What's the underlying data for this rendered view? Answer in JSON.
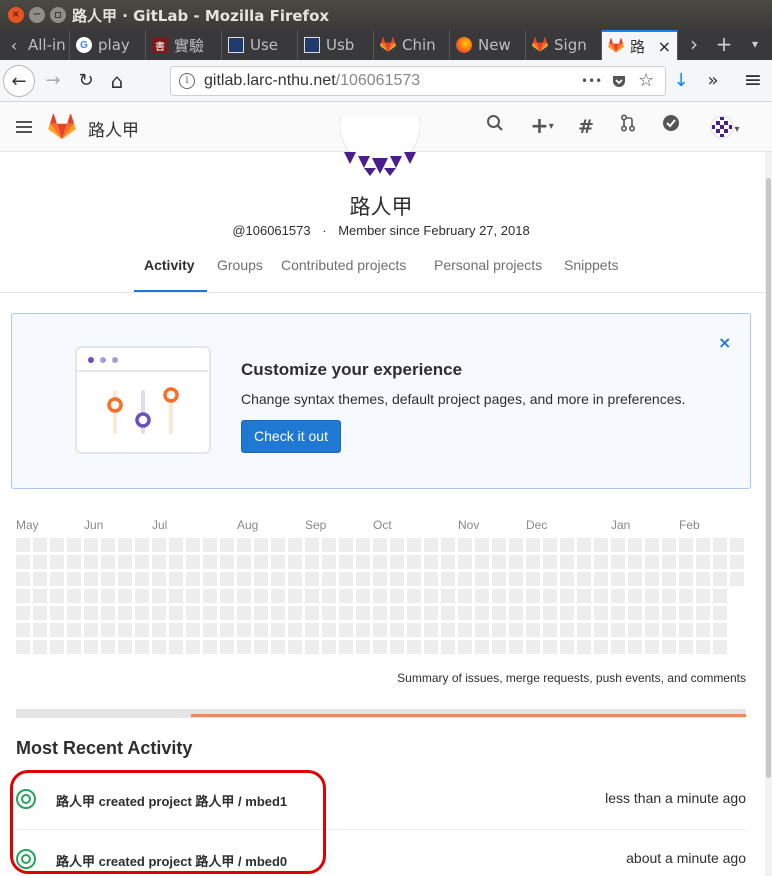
{
  "window": {
    "title": "路人甲 · GitLab - Mozilla Firefox",
    "close_glyph": "×",
    "minimize_glyph": "−"
  },
  "tabs": [
    {
      "label": "All-in",
      "icon": "scroll-left-icon"
    },
    {
      "label": "play",
      "icon": "google-icon"
    },
    {
      "label": "實驗",
      "icon": "book-icon"
    },
    {
      "label": "Use",
      "icon": "document-icon"
    },
    {
      "label": "Usb",
      "icon": "document-icon"
    },
    {
      "label": "Chin",
      "icon": "gitlab-icon"
    },
    {
      "label": "New",
      "icon": "firefox-icon"
    },
    {
      "label": "Sign",
      "icon": "gitlab-icon"
    },
    {
      "label": "路",
      "icon": "gitlab-icon",
      "active": true
    }
  ],
  "tabstrip": {
    "more": "›",
    "new_tab": "+",
    "close": "×"
  },
  "navbar": {
    "back": "←",
    "forward": "→",
    "reload": "↻",
    "home": "⌂",
    "url_host": "gitlab.larc-nthu.net",
    "url_path": "/106061573",
    "info": "i",
    "page_actions": "•••",
    "download": "↓",
    "overflow": "»",
    "menu": "≡"
  },
  "gitlab_header": {
    "username": "路人甲",
    "icons": [
      "search-icon",
      "plus-icon",
      "hash-icon",
      "merge-request-icon",
      "todo-check-icon",
      "user-avatar-icon"
    ]
  },
  "profile": {
    "name": "路人甲",
    "handle": "@106061573",
    "separator": "·",
    "member_since": "Member since February 27, 2018",
    "tabs": [
      "Activity",
      "Groups",
      "Contributed projects",
      "Personal projects",
      "Snippets"
    ],
    "active_tab": "Activity"
  },
  "callout": {
    "title": "Customize your experience",
    "description": "Change syntax themes, default project pages, and more in preferences.",
    "button": "Check it out",
    "dismiss": "×"
  },
  "calendar": {
    "months": [
      "May",
      "Jun",
      "Jul",
      "Aug",
      "Sep",
      "Oct",
      "Nov",
      "Dec",
      "Jan",
      "Feb"
    ],
    "summary": "Summary of issues, merge requests, push events, and comments",
    "cell_color": "#ededed"
  },
  "progress": {
    "fraction": 0.76,
    "color": "#f28566"
  },
  "activity": {
    "title": "Most Recent Activity",
    "items": [
      {
        "text": "路人甲 created project 路人甲 / mbed1",
        "time": "less than a minute ago"
      },
      {
        "text": "路人甲 created project 路人甲 / mbed0",
        "time": "about a minute ago"
      }
    ]
  },
  "colors": {
    "accent": "#1f78d1",
    "gitlab_orange": "#e24329",
    "highlight": "#e00000",
    "success": "#26a35f"
  }
}
